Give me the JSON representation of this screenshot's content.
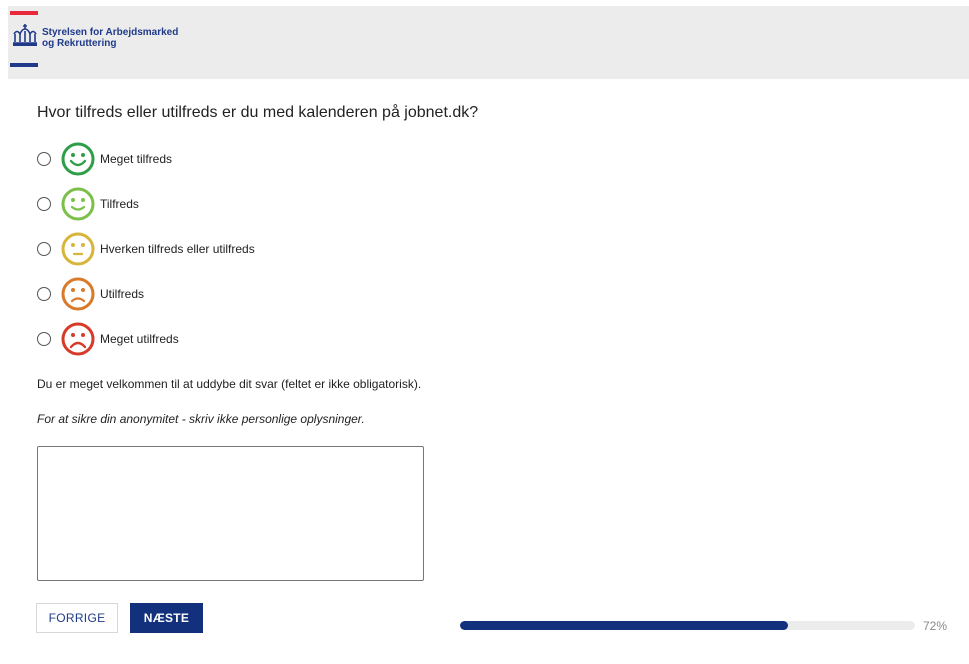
{
  "header": {
    "org_line1": "Styrelsen for Arbejdsmarked",
    "org_line2": "og Rekruttering",
    "brand_blue": "#1f3a8a",
    "brand_red": "#e8293b"
  },
  "survey": {
    "question": "Hvor tilfreds eller utilfreds er du med kalenderen på jobnet.dk?",
    "options": [
      {
        "label": "Meget tilfreds",
        "icon": "very-happy-face-icon",
        "color": "#2e9e48"
      },
      {
        "label": "Tilfreds",
        "icon": "happy-face-icon",
        "color": "#7cc04a"
      },
      {
        "label": "Hverken tilfreds eller utilfreds",
        "icon": "neutral-face-icon",
        "color": "#d7b53a"
      },
      {
        "label": "Utilfreds",
        "icon": "sad-face-icon",
        "color": "#d97a2b"
      },
      {
        "label": "Meget utilfreds",
        "icon": "very-sad-face-icon",
        "color": "#d63b2a"
      }
    ],
    "elaborate_text": "Du er meget velkommen til at uddybe dit svar (feltet er ikke obligatorisk).",
    "anonymity_text": "For at sikre din anonymitet - skriv ikke personlige oplysninger.",
    "comment_value": ""
  },
  "navigation": {
    "prev_label": "FORRIGE",
    "next_label": "NÆSTE"
  },
  "progress": {
    "percent": 72,
    "label": "72%"
  }
}
